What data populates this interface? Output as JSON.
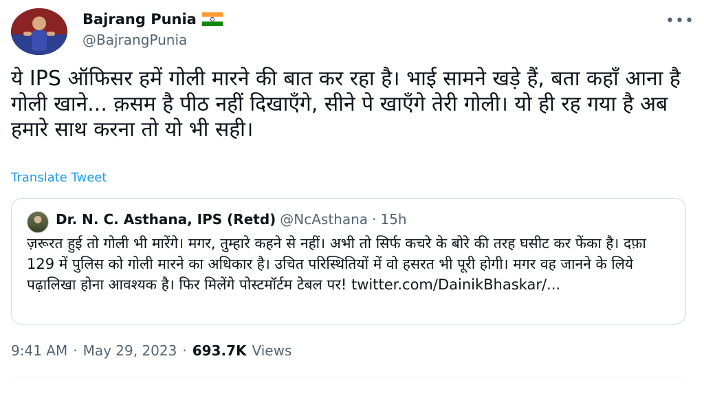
{
  "author": {
    "display_name": "Bajrang Punia",
    "handle": "@BajrangPunia",
    "flag_icon": "india-flag-icon"
  },
  "more_button": "•••",
  "tweet_text": "ये IPS ऑफिसर हमें गोली मारने की बात कर रहा है। भाई सामने खड़े हैं, बता कहाँ आना है गोली खाने... क़सम है पीठ नहीं दिखाएँगे, सीने पे खाएँगे तेरी गोली। यो ही रह गया है अब हमारे साथ करना तो यो भी सही।",
  "translate_label": "Translate Tweet",
  "quote": {
    "display_name": "Dr. N. C. Asthana, IPS (Retd)",
    "handle": "@NcAsthana",
    "separator": "·",
    "time": "15h",
    "text": "ज़रूरत हुई तो गोली भी मारेंगे। मगर, तुम्हारे कहने से नहीं। अभी तो सिर्फ कचरे के बोरे की तरह घसीट कर फेंका है। दफ़ा 129 में पुलिस को गोली मारने का अधिकार है। उचित परिस्थितियों में वो हसरत भी पूरी होगी। मगर वह जानने के लिये पढ़ालिखा होना आवश्यक है। फिर मिलेंगे पोस्टमॉर्टम टेबल पर! twitter.com/DainikBhaskar/..."
  },
  "meta": {
    "time": "9:41 AM",
    "separator": "·",
    "date": "May 29, 2023",
    "separator2": "·",
    "views_count": "693.7K",
    "views_label": "Views"
  },
  "colors": {
    "text": "#0f1419",
    "secondary": "#536471",
    "link": "#1d9bf0",
    "border": "#cfd9de"
  }
}
